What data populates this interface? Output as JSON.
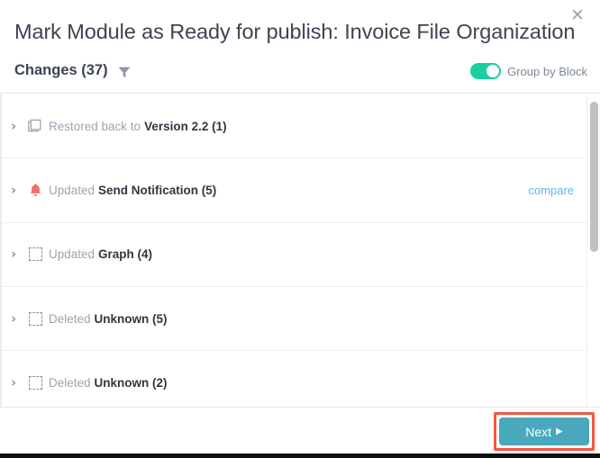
{
  "header": {
    "title": "Mark Module as Ready for publish: Invoice File Organization",
    "close_icon": "close-icon",
    "close_glyph": "✕"
  },
  "subheader": {
    "changes_label": "Changes (37)",
    "filter_icon": "filter-icon",
    "toggle": {
      "label": "Group by Block",
      "state": "on",
      "on_color": "#19cfa0"
    }
  },
  "list": {
    "rows": [
      {
        "chevron": "›",
        "icon": "layers-icon",
        "action": "Restored back to",
        "target": "Version 2.2 (1)",
        "compare_label": ""
      },
      {
        "chevron": "›",
        "icon": "bell-icon",
        "action": "Updated",
        "target": "Send Notification (5)",
        "compare_label": "compare"
      },
      {
        "chevron": "›",
        "icon": "placeholder-icon",
        "action": "Updated",
        "target": "Graph (4)",
        "compare_label": ""
      },
      {
        "chevron": "›",
        "icon": "placeholder-icon",
        "action": "Deleted",
        "target": "Unknown (5)",
        "compare_label": ""
      },
      {
        "chevron": "›",
        "icon": "placeholder-icon",
        "action": "Deleted",
        "target": "Unknown (2)",
        "compare_label": ""
      }
    ]
  },
  "footer": {
    "next_label": "Next",
    "next_caret": "▶",
    "next_color": "#48a8bd",
    "highlight_color": "#f2573d"
  }
}
